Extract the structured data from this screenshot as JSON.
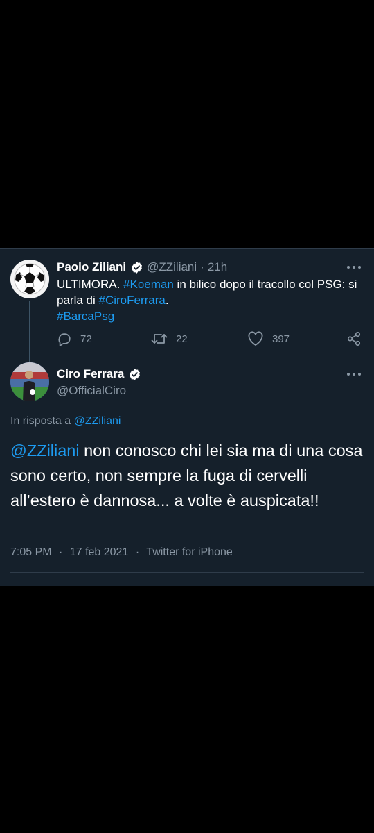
{
  "quoted_tweet": {
    "author_name": "Paolo Ziliani",
    "handle": "@ZZiliani",
    "separator": "·",
    "time": "21h",
    "text_parts": {
      "t1": "ULTIMORA. ",
      "h1": "#Koeman",
      "t2": " in bilico dopo il tracollo col PSG: si parla di ",
      "h2": "#CiroFerrara",
      "t3": ".",
      "h3": "#BarcaPsg"
    },
    "replies": "72",
    "retweets": "22",
    "likes": "397"
  },
  "main_tweet": {
    "author_name": "Ciro Ferrara",
    "handle": "@OfficialCiro",
    "reply_prefix": "In risposta a ",
    "reply_target": "@ZZiliani",
    "mention": "@ZZiliani",
    "text": " non conosco chi lei sia ma di una cosa sono certo, non sempre la fuga di cervelli all’estero è dannosa... a volte è auspicata!!",
    "time": "7:05 PM",
    "dot": "·",
    "date": "17 feb 2021",
    "source": "Twitter for iPhone"
  },
  "icons": {
    "verified": "verified-badge-icon",
    "more": "more-horizontal-icon",
    "reply": "reply-icon",
    "retweet": "retweet-icon",
    "like": "heart-icon",
    "share": "share-icon"
  },
  "colors": {
    "background": "#15202b",
    "link": "#1d9bf0",
    "secondary_text": "#8b98a5"
  }
}
